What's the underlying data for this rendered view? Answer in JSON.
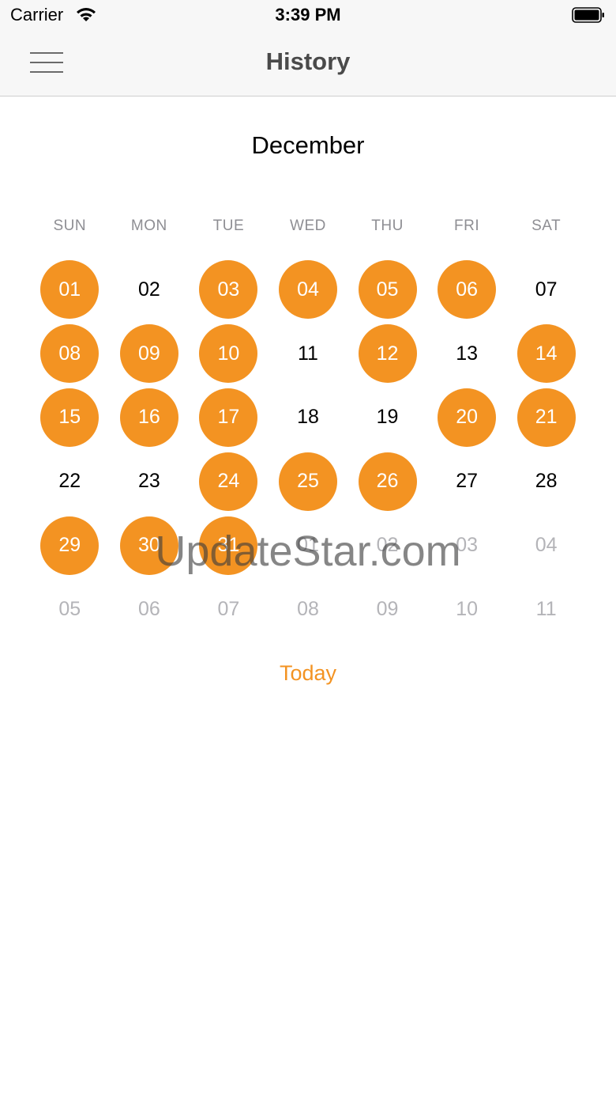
{
  "status_bar": {
    "carrier": "Carrier",
    "time": "3:39 PM",
    "wifi_icon": "wifi-icon",
    "battery_icon": "battery-icon"
  },
  "nav": {
    "title": "History",
    "menu_icon": "hamburger-menu-icon"
  },
  "calendar": {
    "month": "December",
    "weekdays": [
      "SUN",
      "MON",
      "TUE",
      "WED",
      "THU",
      "FRI",
      "SAT"
    ],
    "accent_color": "#f39322",
    "days": [
      {
        "label": "01",
        "marked": true,
        "in_month": true
      },
      {
        "label": "02",
        "marked": false,
        "in_month": true
      },
      {
        "label": "03",
        "marked": true,
        "in_month": true
      },
      {
        "label": "04",
        "marked": true,
        "in_month": true
      },
      {
        "label": "05",
        "marked": true,
        "in_month": true
      },
      {
        "label": "06",
        "marked": true,
        "in_month": true
      },
      {
        "label": "07",
        "marked": false,
        "in_month": true
      },
      {
        "label": "08",
        "marked": true,
        "in_month": true
      },
      {
        "label": "09",
        "marked": true,
        "in_month": true
      },
      {
        "label": "10",
        "marked": true,
        "in_month": true
      },
      {
        "label": "11",
        "marked": false,
        "in_month": true
      },
      {
        "label": "12",
        "marked": true,
        "in_month": true
      },
      {
        "label": "13",
        "marked": false,
        "in_month": true
      },
      {
        "label": "14",
        "marked": true,
        "in_month": true
      },
      {
        "label": "15",
        "marked": true,
        "in_month": true
      },
      {
        "label": "16",
        "marked": true,
        "in_month": true
      },
      {
        "label": "17",
        "marked": true,
        "in_month": true
      },
      {
        "label": "18",
        "marked": false,
        "in_month": true
      },
      {
        "label": "19",
        "marked": false,
        "in_month": true
      },
      {
        "label": "20",
        "marked": true,
        "in_month": true
      },
      {
        "label": "21",
        "marked": true,
        "in_month": true
      },
      {
        "label": "22",
        "marked": false,
        "in_month": true
      },
      {
        "label": "23",
        "marked": false,
        "in_month": true
      },
      {
        "label": "24",
        "marked": true,
        "in_month": true
      },
      {
        "label": "25",
        "marked": true,
        "in_month": true
      },
      {
        "label": "26",
        "marked": true,
        "in_month": true
      },
      {
        "label": "27",
        "marked": false,
        "in_month": true
      },
      {
        "label": "28",
        "marked": false,
        "in_month": true
      },
      {
        "label": "29",
        "marked": true,
        "in_month": true
      },
      {
        "label": "30",
        "marked": true,
        "in_month": true
      },
      {
        "label": "31",
        "marked": true,
        "in_month": true
      },
      {
        "label": "01",
        "marked": false,
        "in_month": false
      },
      {
        "label": "02",
        "marked": false,
        "in_month": false
      },
      {
        "label": "03",
        "marked": false,
        "in_month": false
      },
      {
        "label": "04",
        "marked": false,
        "in_month": false
      },
      {
        "label": "05",
        "marked": false,
        "in_month": false
      },
      {
        "label": "06",
        "marked": false,
        "in_month": false
      },
      {
        "label": "07",
        "marked": false,
        "in_month": false
      },
      {
        "label": "08",
        "marked": false,
        "in_month": false
      },
      {
        "label": "09",
        "marked": false,
        "in_month": false
      },
      {
        "label": "10",
        "marked": false,
        "in_month": false
      },
      {
        "label": "11",
        "marked": false,
        "in_month": false
      }
    ]
  },
  "today_label": "Today",
  "watermark": "UpdateStar.com"
}
